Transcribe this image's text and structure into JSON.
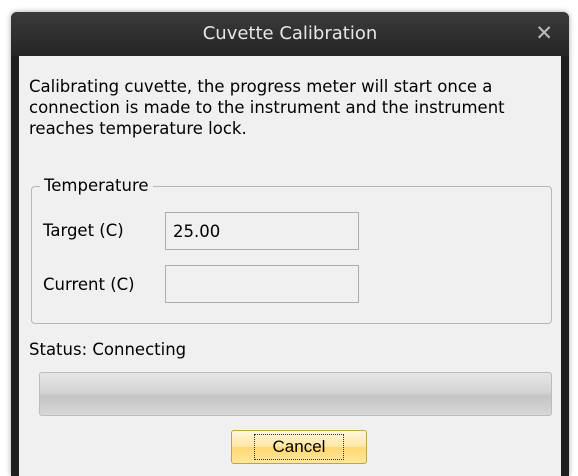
{
  "dialog": {
    "title": "Cuvette Calibration",
    "close_glyph": "✕",
    "message": "Calibrating cuvette, the progress meter will start once a connection is made to the instrument and the instrument reaches temperature lock."
  },
  "temperature": {
    "group_label": "Temperature",
    "target_label": "Target (C)",
    "target_value": "25.00",
    "current_label": "Current (C)",
    "current_value": ""
  },
  "status": {
    "text": "Status: Connecting"
  },
  "progress": {
    "value_fraction": 0.0,
    "track_color": "#d4d4d4"
  },
  "buttons": {
    "cancel_label": "Cancel"
  },
  "colors": {
    "titlebar": "#2b2b2b",
    "client_bg": "#f0f0f0",
    "button_focus": "#ffe08a"
  }
}
